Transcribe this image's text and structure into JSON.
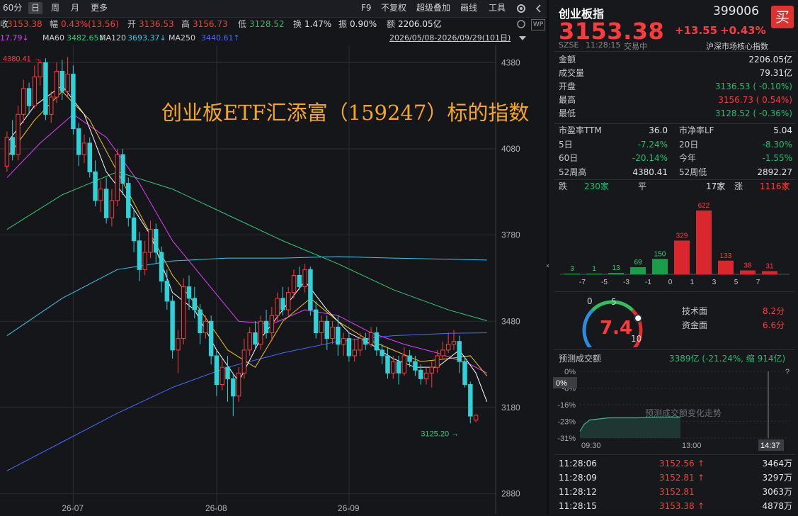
{
  "toolbar": {
    "period_label": "60分",
    "tabs": [
      "日",
      "周",
      "月",
      "更多"
    ],
    "right_items": [
      "F9",
      "不复权",
      "超级叠加",
      "画线",
      "工具"
    ],
    "settings_icon": "gear-icon",
    "chevron_icon": "chevron-down-icon"
  },
  "quote_line": {
    "close_label": "收",
    "close": "3153.38",
    "change_label": "幅",
    "change": "0.43%(13.56)",
    "open_label": "开",
    "open": "3136.53",
    "high_label": "高",
    "high": "3156.73",
    "low_label": "低",
    "low": "3128.52",
    "turnover_label": "换",
    "turnover": "1.47%",
    "amplitude_label": "振",
    "amplitude": "0.90%",
    "amount_label": "额",
    "amount": "2206.05亿"
  },
  "ma_line": {
    "ma_first": "17.79↓",
    "ma60_label": "MA60",
    "ma60": "3482.65↓",
    "ma120_label": "MA120",
    "ma120": "3693.37↓",
    "ma250_label": "MA250",
    "ma250": "3440.61↑",
    "range": "2026/05/08-2026/09/29(101日)"
  },
  "overlay_title": "创业板ETF汇添富（159247）标的指数",
  "chart_data": {
    "type": "candlestick",
    "y_ticks": [
      "4380",
      "4080",
      "3780",
      "3480",
      "3180",
      "2880"
    ],
    "y_tick_values": [
      4380,
      4080,
      3780,
      3480,
      3180,
      2880
    ],
    "ylim": [
      2810,
      4440
    ],
    "x_ticks": [
      "26-07",
      "26-08",
      "26-09"
    ],
    "x_tick_index": [
      12,
      38,
      62
    ],
    "high_annot": "4380.41",
    "low_annot": "3125.20",
    "colors": {
      "up": "#ff3b3b",
      "down": "#2fd2d6",
      "ma5": "#ffffff",
      "ma10": "#f5c518",
      "ma20": "#e040fb",
      "ma60": "#2ecc71",
      "ma120": "#33c9e8",
      "ma250": "#4a6cff"
    },
    "candles": [
      [
        4020,
        4120,
        4000,
        4140
      ],
      [
        4120,
        4060,
        4040,
        4180
      ],
      [
        4060,
        4200,
        4040,
        4230
      ],
      [
        4200,
        4290,
        4170,
        4320
      ],
      [
        4290,
        4230,
        4200,
        4310
      ],
      [
        4230,
        4330,
        4220,
        4370
      ],
      [
        4330,
        4380,
        4300,
        4390
      ],
      [
        4380,
        4200,
        4180,
        4395
      ],
      [
        4200,
        4260,
        4170,
        4280
      ],
      [
        4260,
        4350,
        4240,
        4380
      ],
      [
        4350,
        4280,
        4250,
        4390
      ],
      [
        4280,
        4340,
        4260,
        4400
      ],
      [
        4340,
        4150,
        4130,
        4370
      ],
      [
        4150,
        4060,
        4020,
        4170
      ],
      [
        4060,
        4100,
        4030,
        4130
      ],
      [
        4100,
        4000,
        3980,
        4120
      ],
      [
        4000,
        3900,
        3880,
        4040
      ],
      [
        3900,
        3940,
        3860,
        3970
      ],
      [
        3940,
        3840,
        3820,
        3980
      ],
      [
        3840,
        3900,
        3810,
        3940
      ],
      [
        3900,
        4060,
        3880,
        4080
      ],
      [
        4060,
        3960,
        3920,
        4080
      ],
      [
        3960,
        3840,
        3810,
        3980
      ],
      [
        3840,
        3760,
        3720,
        3870
      ],
      [
        3760,
        3660,
        3620,
        3790
      ],
      [
        3660,
        3720,
        3640,
        3760
      ],
      [
        3720,
        3800,
        3700,
        3830
      ],
      [
        3800,
        3720,
        3680,
        3820
      ],
      [
        3720,
        3620,
        3580,
        3740
      ],
      [
        3620,
        3550,
        3520,
        3660
      ],
      [
        3550,
        3380,
        3350,
        3570
      ],
      [
        3380,
        3420,
        3300,
        3450
      ],
      [
        3420,
        3600,
        3400,
        3630
      ],
      [
        3600,
        3560,
        3520,
        3640
      ],
      [
        3560,
        3520,
        3490,
        3600
      ],
      [
        3520,
        3440,
        3400,
        3540
      ],
      [
        3440,
        3480,
        3420,
        3500
      ],
      [
        3480,
        3360,
        3330,
        3500
      ],
      [
        3360,
        3260,
        3220,
        3380
      ],
      [
        3260,
        3320,
        3240,
        3350
      ],
      [
        3320,
        3280,
        3200,
        3360
      ],
      [
        3280,
        3220,
        3150,
        3300
      ],
      [
        3220,
        3300,
        3200,
        3320
      ],
      [
        3300,
        3380,
        3280,
        3420
      ],
      [
        3380,
        3440,
        3360,
        3460
      ],
      [
        3440,
        3400,
        3380,
        3480
      ],
      [
        3400,
        3480,
        3380,
        3500
      ],
      [
        3480,
        3440,
        3420,
        3520
      ],
      [
        3440,
        3500,
        3410,
        3530
      ],
      [
        3500,
        3560,
        3480,
        3580
      ],
      [
        3560,
        3520,
        3500,
        3600
      ],
      [
        3520,
        3580,
        3500,
        3600
      ],
      [
        3580,
        3640,
        3560,
        3660
      ],
      [
        3640,
        3600,
        3590,
        3670
      ],
      [
        3600,
        3660,
        3580,
        3680
      ],
      [
        3660,
        3520,
        3500,
        3670
      ],
      [
        3520,
        3440,
        3420,
        3550
      ],
      [
        3440,
        3480,
        3400,
        3500
      ],
      [
        3480,
        3420,
        3380,
        3500
      ],
      [
        3420,
        3460,
        3400,
        3480
      ],
      [
        3460,
        3400,
        3360,
        3500
      ],
      [
        3400,
        3420,
        3360,
        3440
      ],
      [
        3420,
        3360,
        3340,
        3440
      ],
      [
        3360,
        3380,
        3340,
        3420
      ],
      [
        3380,
        3420,
        3360,
        3440
      ],
      [
        3420,
        3400,
        3380,
        3440
      ],
      [
        3400,
        3440,
        3390,
        3460
      ],
      [
        3440,
        3380,
        3360,
        3460
      ],
      [
        3380,
        3360,
        3330,
        3400
      ],
      [
        3360,
        3300,
        3280,
        3390
      ],
      [
        3300,
        3340,
        3280,
        3360
      ],
      [
        3340,
        3300,
        3260,
        3360
      ],
      [
        3300,
        3360,
        3290,
        3390
      ],
      [
        3360,
        3340,
        3320,
        3380
      ],
      [
        3340,
        3310,
        3290,
        3360
      ],
      [
        3310,
        3280,
        3260,
        3330
      ],
      [
        3280,
        3300,
        3260,
        3320
      ],
      [
        3300,
        3320,
        3250,
        3340
      ],
      [
        3320,
        3360,
        3300,
        3380
      ],
      [
        3360,
        3380,
        3350,
        3410
      ],
      [
        3380,
        3400,
        3370,
        3440
      ],
      [
        3400,
        3410,
        3380,
        3450
      ],
      [
        3410,
        3340,
        3300,
        3430
      ],
      [
        3340,
        3260,
        3250,
        3360
      ],
      [
        3260,
        3150,
        3125,
        3270
      ],
      [
        3136,
        3153,
        3128,
        3157
      ]
    ],
    "ma_lines": {
      "ma5": [
        [
          0,
          4100
        ],
        [
          5,
          4230
        ],
        [
          10,
          4300
        ],
        [
          14,
          4200
        ],
        [
          18,
          4000
        ],
        [
          22,
          3900
        ],
        [
          26,
          3780
        ],
        [
          30,
          3580
        ],
        [
          34,
          3520
        ],
        [
          38,
          3380
        ],
        [
          42,
          3270
        ],
        [
          46,
          3420
        ],
        [
          50,
          3520
        ],
        [
          54,
          3620
        ],
        [
          58,
          3520
        ],
        [
          62,
          3440
        ],
        [
          66,
          3400
        ],
        [
          70,
          3350
        ],
        [
          74,
          3320
        ],
        [
          78,
          3320
        ],
        [
          82,
          3380
        ],
        [
          85,
          3300
        ],
        [
          87,
          3200
        ]
      ],
      "ma10": [
        [
          0,
          4050
        ],
        [
          5,
          4180
        ],
        [
          10,
          4280
        ],
        [
          15,
          4180
        ],
        [
          20,
          4000
        ],
        [
          25,
          3820
        ],
        [
          30,
          3640
        ],
        [
          35,
          3520
        ],
        [
          40,
          3380
        ],
        [
          45,
          3320
        ],
        [
          50,
          3480
        ],
        [
          55,
          3560
        ],
        [
          60,
          3480
        ],
        [
          65,
          3420
        ],
        [
          70,
          3380
        ],
        [
          75,
          3340
        ],
        [
          80,
          3350
        ],
        [
          84,
          3360
        ],
        [
          87,
          3290
        ]
      ],
      "ma20": [
        [
          0,
          3980
        ],
        [
          6,
          4100
        ],
        [
          12,
          4200
        ],
        [
          18,
          4120
        ],
        [
          24,
          3960
        ],
        [
          30,
          3760
        ],
        [
          36,
          3620
        ],
        [
          42,
          3480
        ],
        [
          48,
          3470
        ],
        [
          54,
          3520
        ],
        [
          60,
          3500
        ],
        [
          66,
          3440
        ],
        [
          72,
          3400
        ],
        [
          78,
          3370
        ],
        [
          84,
          3330
        ],
        [
          87,
          3300
        ]
      ],
      "ma60": [
        [
          0,
          3800
        ],
        [
          10,
          3920
        ],
        [
          20,
          4000
        ],
        [
          30,
          3940
        ],
        [
          40,
          3850
        ],
        [
          50,
          3760
        ],
        [
          60,
          3680
        ],
        [
          70,
          3590
        ],
        [
          80,
          3520
        ],
        [
          87,
          3482
        ]
      ],
      "ma120": [
        [
          0,
          3430
        ],
        [
          10,
          3560
        ],
        [
          20,
          3660
        ],
        [
          30,
          3690
        ],
        [
          40,
          3700
        ],
        [
          50,
          3700
        ],
        [
          60,
          3705
        ],
        [
          70,
          3700
        ],
        [
          80,
          3696
        ],
        [
          87,
          3693
        ]
      ],
      "ma250": [
        [
          0,
          2960
        ],
        [
          10,
          3060
        ],
        [
          20,
          3160
        ],
        [
          30,
          3250
        ],
        [
          40,
          3320
        ],
        [
          50,
          3370
        ],
        [
          60,
          3410
        ],
        [
          70,
          3430
        ],
        [
          80,
          3438
        ],
        [
          87,
          3440
        ]
      ]
    }
  },
  "panel": {
    "name": "创业板指",
    "code": "399006",
    "buy_label": "买",
    "price": "3153.38",
    "change": "+13.55",
    "change_pct": "+0.43%",
    "exchange": "SZSE",
    "time": "11:28:15",
    "status": "交易中",
    "category": "沪深市场核心指数",
    "rows": [
      {
        "label": "金额",
        "value": "2206.05亿",
        "color": "white"
      },
      {
        "label": "成交量",
        "value": "79.31亿",
        "color": "white"
      },
      {
        "label": "开盘",
        "value": "3136.53 ( -0.10%)",
        "color": "green"
      },
      {
        "label": "最高",
        "value": "3156.73 ( 0.54%)",
        "color": "red"
      },
      {
        "label": "最低",
        "value": "3128.52 ( -0.36%)",
        "color": "green"
      }
    ],
    "grid": [
      {
        "l1": "市盈率TTM",
        "v1": "36.0",
        "c1": "white",
        "l2": "市净率LF",
        "v2": "5.04",
        "c2": "white"
      },
      {
        "l1": "5日",
        "v1": "-7.24%",
        "c1": "green",
        "l2": "20日",
        "v2": "-8.30%",
        "c2": "green"
      },
      {
        "l1": "60日",
        "v1": "-20.14%",
        "c1": "green",
        "l2": "今年",
        "v2": "-1.55%",
        "c2": "green"
      },
      {
        "l1": "52周高",
        "v1": "4380.41",
        "c1": "white",
        "l2": "52周低",
        "v2": "2892.27",
        "c2": "white"
      }
    ],
    "breadth": {
      "down_label": "跌",
      "down": "230家",
      "flat_label": "平",
      "flat": "17家",
      "up_label": "涨",
      "up": "1116家"
    },
    "dist": {
      "values": [
        3,
        1,
        13,
        69,
        150,
        329,
        622,
        133,
        38,
        31
      ],
      "labels": [
        "-7",
        "-5",
        "-3",
        "-1",
        "0",
        "1",
        "3",
        "5",
        "7"
      ],
      "colors": [
        "#1a9e4a",
        "#1a9e4a",
        "#1a9e4a",
        "#1a9e4a",
        "#1a9e4a",
        "#d9272e",
        "#d9272e",
        "#d9272e",
        "#d9272e",
        "#d9272e"
      ]
    },
    "gauge": {
      "score": "7.4",
      "min": "0",
      "mid": "5",
      "max": "10",
      "tech_label": "技术面",
      "tech": "8.2分",
      "fund_label": "资金面",
      "fund": "6.6分"
    },
    "forecast": {
      "title": "预测成交额",
      "value": "3389亿 (-21.24%, 缩 914亿)",
      "help": "?",
      "y_labels": [
        "0%",
        "-8%",
        "-16%",
        "-23%",
        "-31%"
      ],
      "badge": "0%",
      "watermark": "预测成交额变化走势",
      "x_labels": [
        "09:30",
        "13:00",
        "14:37"
      ]
    },
    "ticks": [
      {
        "time": "11:28:06",
        "price": "3152.56",
        "arrow": "↑",
        "vol": "3464万"
      },
      {
        "time": "11:28:09",
        "price": "3152.81",
        "arrow": "↑",
        "vol": "3297万"
      },
      {
        "time": "11:28:12",
        "price": "3152.81",
        "arrow": "",
        "vol": "3063万"
      },
      {
        "time": "11:28:15",
        "price": "3153.38",
        "arrow": "↑",
        "vol": "4878万"
      }
    ]
  }
}
